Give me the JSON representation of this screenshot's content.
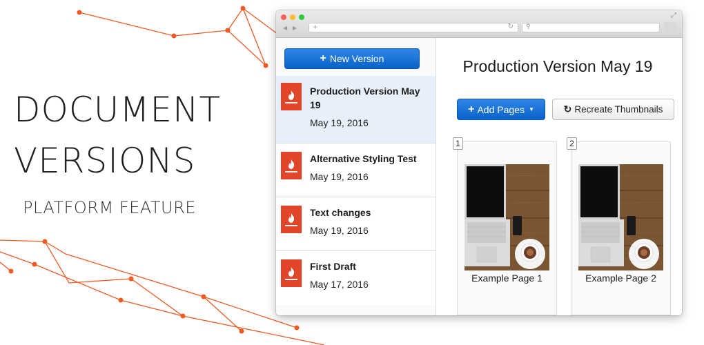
{
  "hero": {
    "title_line1": "DOCUMENT",
    "title_line2": "VERSIONS",
    "subtitle": "PLATFORM FEATURE",
    "accent_color": "#f05a22"
  },
  "browser": {
    "address_value": "",
    "search_value": ""
  },
  "sidebar": {
    "new_version_label": "New Version",
    "items": [
      {
        "name": "Production Version May 19",
        "date": "May 19, 2016",
        "active": true
      },
      {
        "name": "Alternative Styling Test",
        "date": "May 19, 2016",
        "active": false
      },
      {
        "name": "Text changes",
        "date": "May 19, 2016",
        "active": false
      },
      {
        "name": "First Draft",
        "date": "May 17, 2016",
        "active": false
      }
    ]
  },
  "main": {
    "heading": "Production Version May 19",
    "add_pages_label": "Add Pages",
    "recreate_label": "Recreate Thumbnails",
    "pages": [
      {
        "number": "1",
        "label": "Example Page 1"
      },
      {
        "number": "2",
        "label": "Example Page 2"
      }
    ]
  },
  "colors": {
    "primary_button": "#0a63c9",
    "active_row": "#e7f0fa",
    "logo": "#e1462b"
  }
}
